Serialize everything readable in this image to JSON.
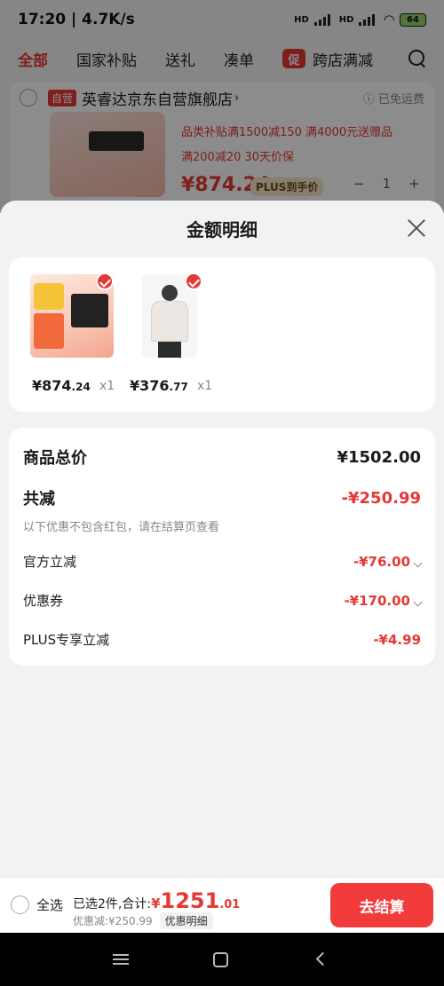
{
  "status_bar": {
    "time_speed": "17:20 | 4.7K/s",
    "battery": "64",
    "hd1": "HD",
    "hd2": "HD"
  },
  "tabs": [
    {
      "label": "全部"
    },
    {
      "label": "国家补贴"
    },
    {
      "label": "送礼"
    },
    {
      "label": "凑单"
    },
    {
      "label": "跨店满减",
      "badge": "促"
    }
  ],
  "store": {
    "self_tag": "自营",
    "name": "英睿达京东自营旗舰店",
    "shipping": "已免运费",
    "promo1": "品类补贴满1500减150  满4000元送赠品",
    "promo2": "满200减20  30天价保",
    "price": "¥874.24",
    "plus_label": "PLUS到手价",
    "qty": "1"
  },
  "sheet": {
    "title": "金额明细",
    "items": [
      {
        "price_int": "¥874",
        "price_dec": ".24",
        "qty": "x1"
      },
      {
        "price_int": "¥376",
        "price_dec": ".77",
        "qty": "x1"
      }
    ],
    "summary": {
      "total_label": "商品总价",
      "total_value": "¥1502.00",
      "reduce_label": "共减",
      "reduce_value": "-¥250.99",
      "reduce_note": "以下优惠不包含红包，请在结算页查看",
      "official_label": "官方立减",
      "official_value": "-¥76.00",
      "coupon_label": "优惠券",
      "coupon_value": "-¥170.00",
      "plus_label": "PLUS专享立减",
      "plus_value": "-¥4.99"
    }
  },
  "bottom_bar": {
    "select_all": "全选",
    "selected_text": "已选2件,合计:",
    "total_yen": "¥",
    "total_int": "1251",
    "total_dec": ".01",
    "discount_text": "优惠减:¥250.99",
    "detail_chip": "优惠明细",
    "checkout": "去结算"
  },
  "colors": {
    "accent": "#e53935",
    "checkout": "#f23c3c"
  }
}
